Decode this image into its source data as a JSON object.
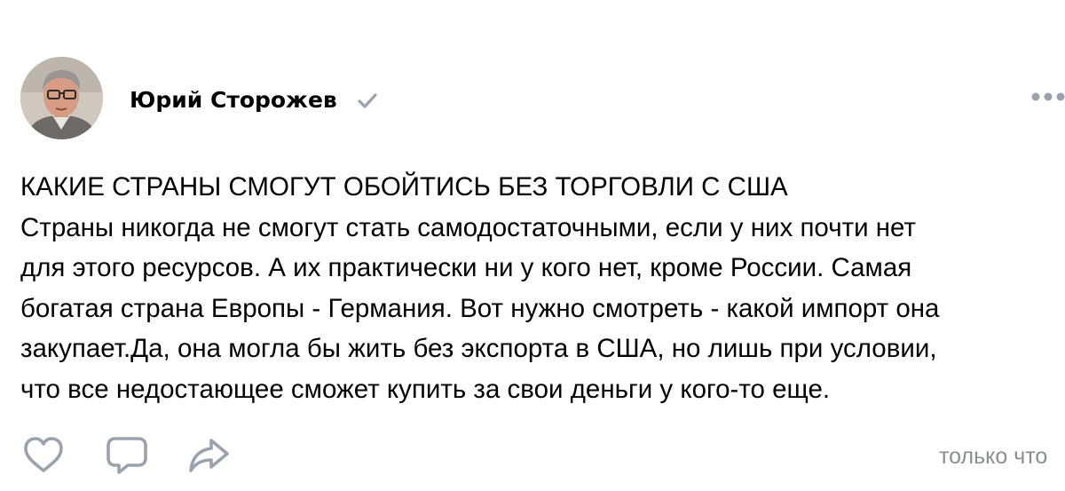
{
  "post": {
    "author": {
      "name": "Юрий Сторожев",
      "verified_icon": "checkmark-icon"
    },
    "more_icon": "more-dots-icon",
    "text_lines": [
      "КАКИЕ СТРАНЫ СМОГУТ ОБОЙТИСЬ БЕЗ ТОРГОВЛИ С США",
      "Страны никогда не смогут стать самодостаточными, если у них почти нет",
      "для этого ресурсов. А их практически ни у кого нет, кроме России. Самая",
      "богатая страна Европы - Германия. Вот нужно смотреть - какой импорт она",
      "закупает.Да, она могла бы жить без экспорта в США, но лишь при условии,",
      "что все недостающее сможет купить за свои деньги у кого-то еще."
    ],
    "actions": {
      "like_icon": "heart-icon",
      "comment_icon": "comment-icon",
      "share_icon": "share-icon"
    },
    "meta_text": "только что"
  },
  "colors": {
    "text": "#000000",
    "icon_gray": "#99a2ad",
    "meta_gray": "#8a8d91"
  }
}
